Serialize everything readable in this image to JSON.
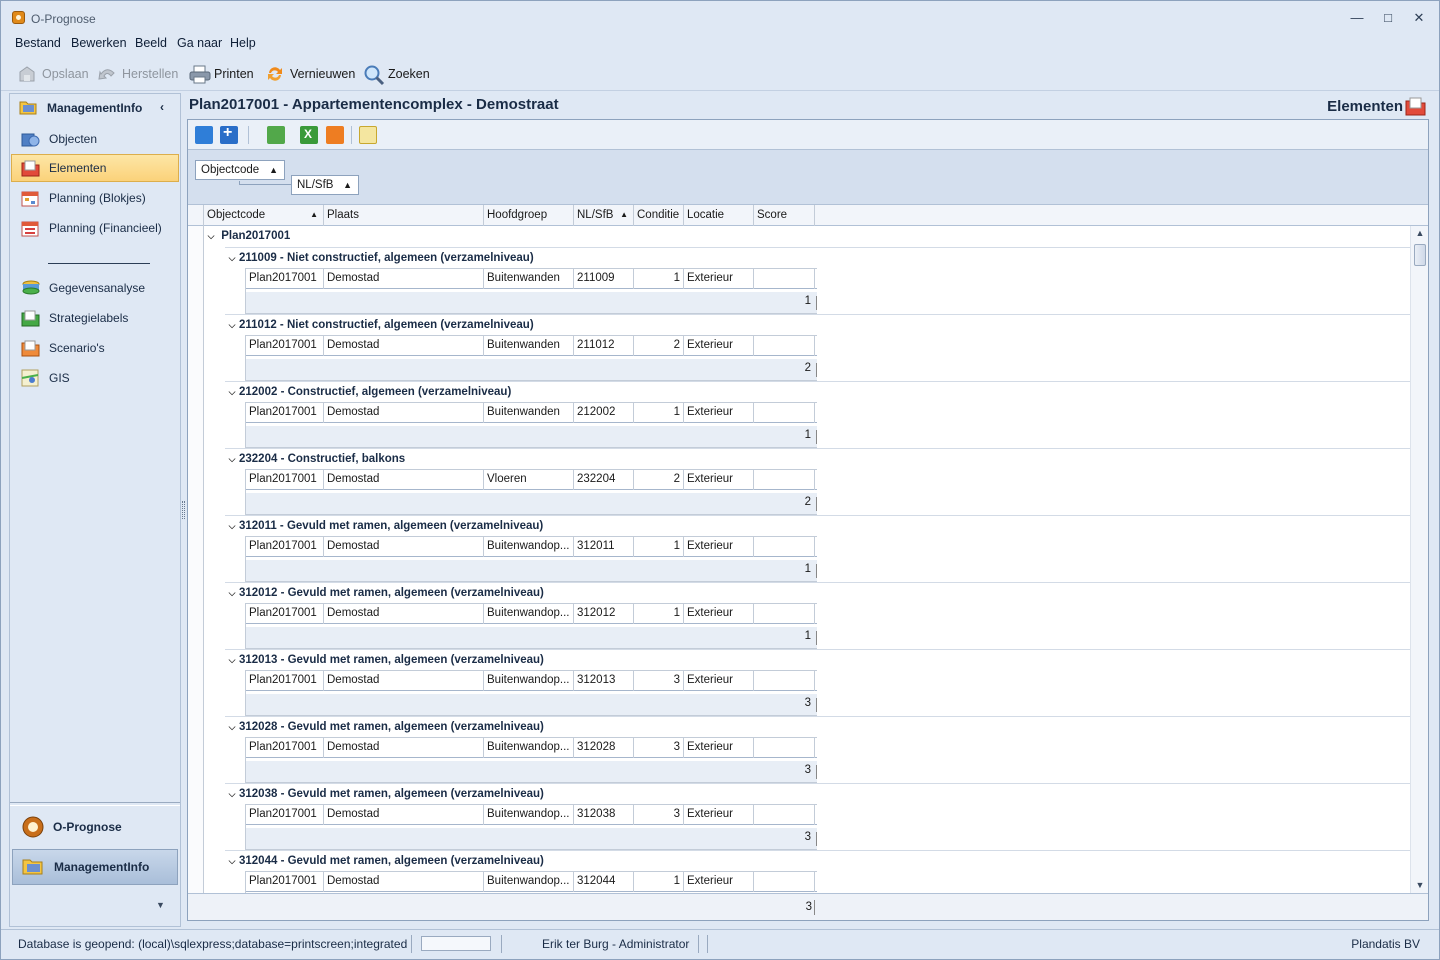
{
  "window": {
    "title": "O-Prognose",
    "controls": [
      "minimize-icon",
      "maximize-icon",
      "close-icon"
    ]
  },
  "menu": [
    "Bestand",
    "Bewerken",
    "Beeld",
    "Ga naar",
    "Help"
  ],
  "toolbar": {
    "save": "Opslaan",
    "restore": "Herstellen",
    "print": "Printen",
    "refresh": "Vernieuwen",
    "search": "Zoeken"
  },
  "sidebar": {
    "header": "ManagementInfo",
    "items": [
      {
        "label": "Objecten",
        "icon": "objects-icon"
      },
      {
        "label": "Elementen",
        "icon": "folder-red-icon"
      },
      {
        "label": "Planning (Blokjes)",
        "icon": "calendar-icon"
      },
      {
        "label": "Planning (Financieel)",
        "icon": "calendar-money-icon"
      },
      {
        "label": "Gegevensanalyse",
        "icon": "analysis-icon"
      },
      {
        "label": "Strategielabels",
        "icon": "folder-green-icon"
      },
      {
        "label": "Scenario's",
        "icon": "folder-orange-icon"
      },
      {
        "label": "GIS",
        "icon": "map-icon"
      }
    ],
    "nav": [
      {
        "label": "O-Prognose",
        "icon": "prognose-icon"
      },
      {
        "label": "ManagementInfo",
        "icon": "folder-yellow-icon"
      }
    ]
  },
  "main": {
    "title": "Plan2017001 - Appartementencomplex - Demostraat",
    "section": "Elementen"
  },
  "grid": {
    "group_by": [
      "Objectcode",
      "NL/SfB"
    ],
    "columns": [
      "Objectcode",
      "Plaats",
      "Hoofdgroep",
      "NL/SfB",
      "Conditie",
      "Locatie",
      "Score"
    ],
    "top_group": "Plan2017001",
    "groups": [
      {
        "title": "211009 - Niet constructief, algemeen (verzamelniveau)",
        "row": [
          "Plan2017001",
          "Demostad",
          "Buitenwanden",
          "211009",
          "1",
          "Exterieur",
          ""
        ],
        "summary": "1"
      },
      {
        "title": "211012 - Niet constructief, algemeen (verzamelniveau)",
        "row": [
          "Plan2017001",
          "Demostad",
          "Buitenwanden",
          "211012",
          "2",
          "Exterieur",
          ""
        ],
        "summary": "2"
      },
      {
        "title": "212002 - Constructief, algemeen (verzamelniveau)",
        "row": [
          "Plan2017001",
          "Demostad",
          "Buitenwanden",
          "212002",
          "1",
          "Exterieur",
          ""
        ],
        "summary": "1"
      },
      {
        "title": "232204 - Constructief, balkons",
        "row": [
          "Plan2017001",
          "Demostad",
          "Vloeren",
          "232204",
          "2",
          "Exterieur",
          ""
        ],
        "summary": "2"
      },
      {
        "title": "312011 - Gevuld met ramen, algemeen (verzamelniveau)",
        "row": [
          "Plan2017001",
          "Demostad",
          "Buitenwandop...",
          "312011",
          "1",
          "Exterieur",
          ""
        ],
        "summary": "1"
      },
      {
        "title": "312012 - Gevuld met ramen, algemeen (verzamelniveau)",
        "row": [
          "Plan2017001",
          "Demostad",
          "Buitenwandop...",
          "312012",
          "1",
          "Exterieur",
          ""
        ],
        "summary": "1"
      },
      {
        "title": "312013 - Gevuld met ramen, algemeen (verzamelniveau)",
        "row": [
          "Plan2017001",
          "Demostad",
          "Buitenwandop...",
          "312013",
          "3",
          "Exterieur",
          ""
        ],
        "summary": "3"
      },
      {
        "title": "312028 - Gevuld met ramen, algemeen (verzamelniveau)",
        "row": [
          "Plan2017001",
          "Demostad",
          "Buitenwandop...",
          "312028",
          "3",
          "Exterieur",
          ""
        ],
        "summary": "3"
      },
      {
        "title": "312038 - Gevuld met ramen, algemeen (verzamelniveau)",
        "row": [
          "Plan2017001",
          "Demostad",
          "Buitenwandop...",
          "312038",
          "3",
          "Exterieur",
          ""
        ],
        "summary": "3"
      },
      {
        "title": "312044 - Gevuld met ramen, algemeen (verzamelniveau)",
        "row": [
          "Plan2017001",
          "Demostad",
          "Buitenwandop...",
          "312044",
          "1",
          "Exterieur",
          ""
        ],
        "summary": ""
      }
    ],
    "footer_total": "3"
  },
  "status": {
    "db": "Database is geopend: (local)\\sqlexpress;database=printscreen;integrated",
    "user": "Erik ter Burg - Administrator",
    "company": "Plandatis BV"
  },
  "colors": {
    "accent": "#fbd27a",
    "frame": "#8da2bd",
    "background": "#dfe8f4"
  }
}
